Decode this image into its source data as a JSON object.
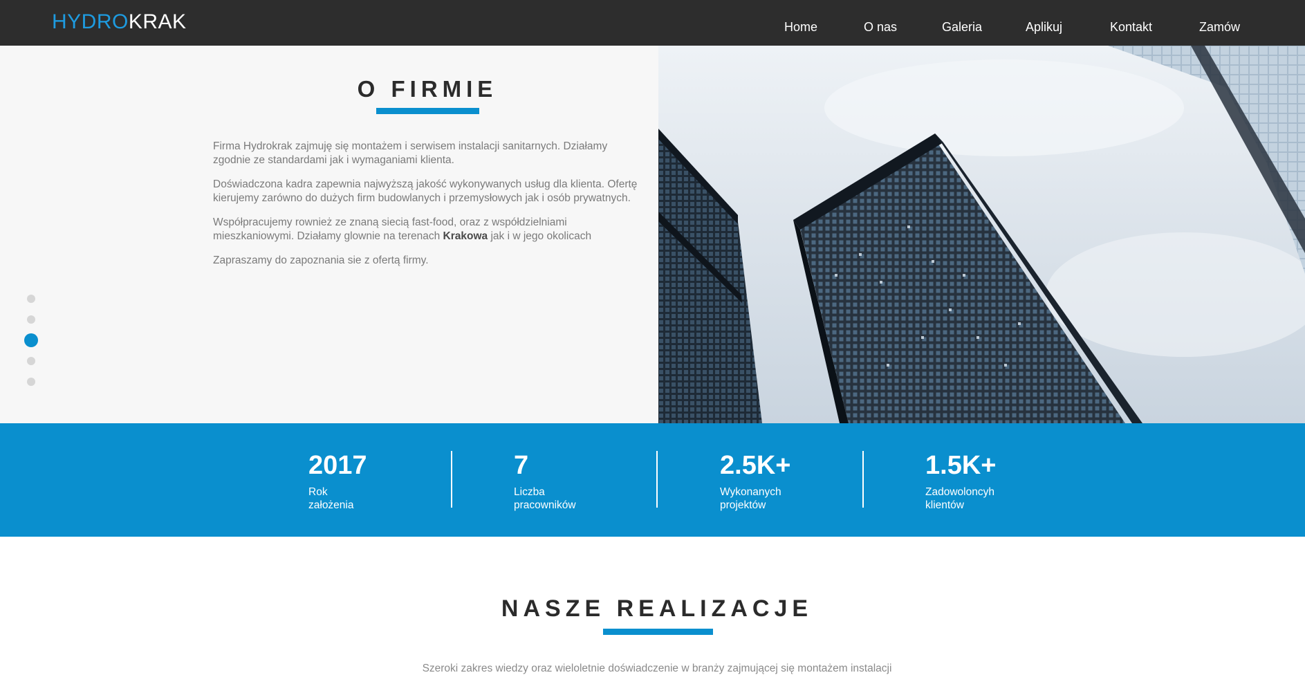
{
  "nav": {
    "logo_part1": "HYDRO",
    "logo_part2": "KRAK",
    "items": [
      "Home",
      "O nas",
      "Galeria",
      "Aplikuj",
      "Kontakt",
      "Zamów"
    ]
  },
  "about": {
    "title": "O FIRMIE",
    "p1": "Firma Hydrokrak zajmuję się montażem i serwisem instalacji sanitarnych. Działamy zgodnie ze standardami jak i wymaganiami klienta.",
    "p2": "Doświadczona kadra zapewnia najwyższą jakość wykonywanych usług dla klienta. Ofertę kierujemy zarówno do dużych firm budowlanych i przemysłowych jak i osób prywatnych.",
    "p3_before": "Współpracujemy rownież ze znaną siecią fast-food, oraz z współdzielniami mieszkaniowymi. Działamy glownie na terenach ",
    "p3_bold": "Krakowa",
    "p3_after": " jak i w jego okolicach",
    "p4": "Zapraszamy do zapoznania sie z ofertą firmy.",
    "dots": {
      "count": 5,
      "active_index": 2
    }
  },
  "stats": [
    {
      "number": "2017",
      "line1": "Rok",
      "line2": "założenia"
    },
    {
      "number": "7",
      "line1": "Liczba",
      "line2": "pracowników"
    },
    {
      "number": "2.5K+",
      "line1": "Wykonanych",
      "line2": "projektów"
    },
    {
      "number": "1.5K+",
      "line1": "Zadowoloncyh",
      "line2": "klientów"
    }
  ],
  "realizacje": {
    "title": "NASZE REALIZACJE",
    "text": "Szeroki zakres wiedzy oraz wieloletnie doświadczenie w branży zajmującej się montażem instalacji"
  },
  "colors": {
    "accent": "#0a8fce",
    "logo_blue": "#1e9be0",
    "navbar": "#2d2d2d",
    "about_bg": "#f7f7f7"
  }
}
